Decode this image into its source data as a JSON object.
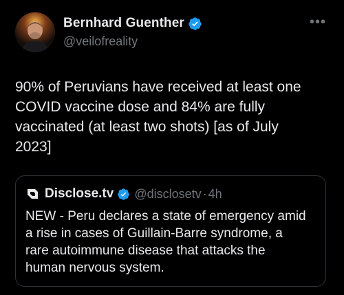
{
  "author": {
    "display_name": "Bernhard Guenther",
    "handle": "@veilofreality"
  },
  "more_icon": "•••",
  "tweet_text": "90% of Peruvians have received at least one\nCOVID vaccine dose and 84% are fully\nvaccinated (at least two shots) [as of July\n2023]",
  "quoted": {
    "display_name": "Disclose.tv",
    "handle": "@disclosetv",
    "separator": "·",
    "time": "4h",
    "text": "NEW - Peru declares a state of emergency amid\na rise in cases of Guillain-Barre syndrome, a\nrare autoimmune disease that attacks the\nhuman nervous system."
  },
  "icons": {
    "verified": "verified-badge-icon",
    "more": "more-options-icon",
    "quote_avatar": "disclose-logo-icon"
  },
  "colors": {
    "background": "#000000",
    "text": "#e7e9ea",
    "secondary": "#71767b",
    "verified_blue": "#1d9bf0",
    "border": "#2f3336"
  }
}
